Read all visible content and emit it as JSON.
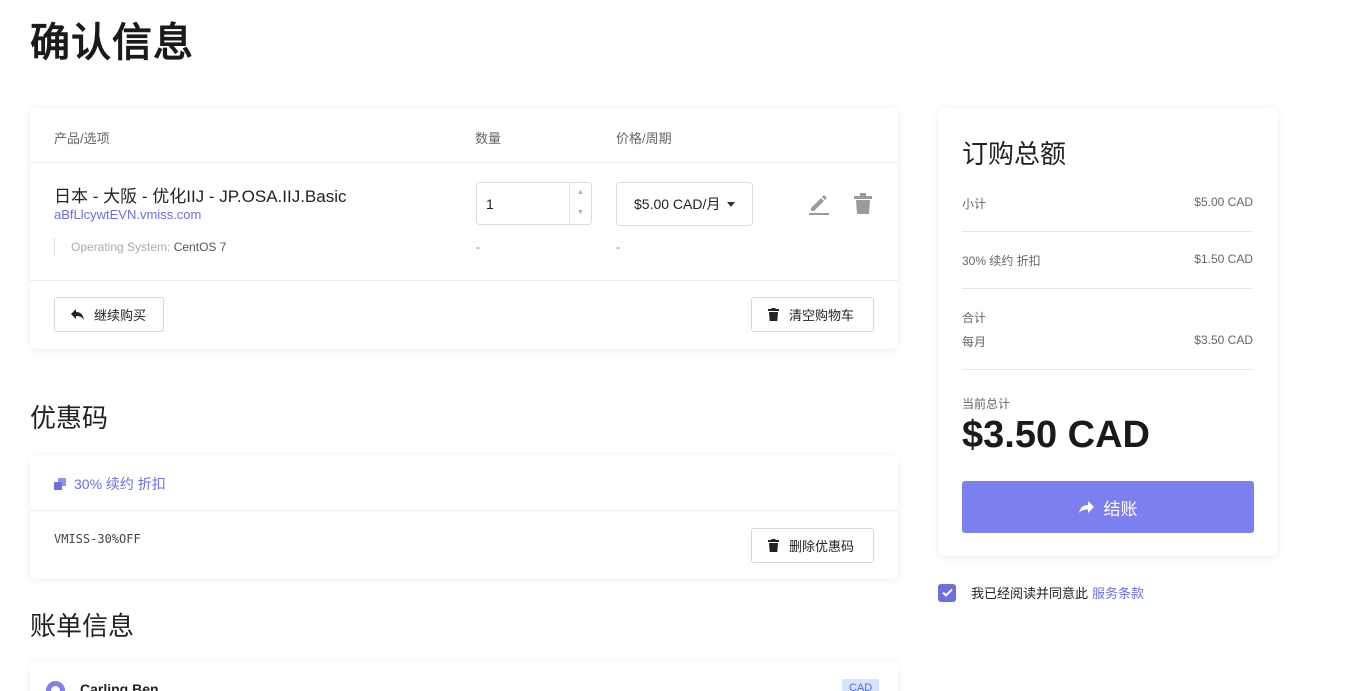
{
  "page_title": "确认信息",
  "cart": {
    "headers": {
      "product": "产品/选项",
      "quantity": "数量",
      "price": "价格/周期"
    },
    "item": {
      "name": "日本 - 大阪 - 优化IIJ - JP.OSA.IIJ.Basic",
      "hostname": "aBfLlcywtEVN.vmiss.com",
      "option_label": "Operating System:",
      "option_value": "CentOS 7",
      "quantity": "1",
      "price": "$5.00 CAD/月",
      "quantity_dash": "-",
      "price_dash": "-"
    },
    "continue_label": "继续购买",
    "empty_label": "清空购物车"
  },
  "coupon": {
    "section_title": "优惠码",
    "label": "30% 续约 折扣",
    "code": "VMISS-30%OFF",
    "remove_label": "删除优惠码"
  },
  "billing": {
    "section_title": "账单信息",
    "name": "Carling Ben",
    "badge": "CAD"
  },
  "summary": {
    "title": "订购总额",
    "subtotal_label": "小计",
    "subtotal_value": "$5.00 CAD",
    "discount_label": "30% 续约 折扣",
    "discount_value": "$1.50 CAD",
    "total_label": "合计",
    "monthly_label": "每月",
    "monthly_value": "$3.50 CAD",
    "current_total_label": "当前总计",
    "current_total_value": "$3.50 CAD",
    "checkout_label": "结账"
  },
  "agreement": {
    "text": "我已经阅读并同意此",
    "link": "服务条款",
    "checked": true
  },
  "colors": {
    "accent": "#7b7fef",
    "link": "#6b6fe0",
    "badge_bg": "#d6e4ff"
  }
}
